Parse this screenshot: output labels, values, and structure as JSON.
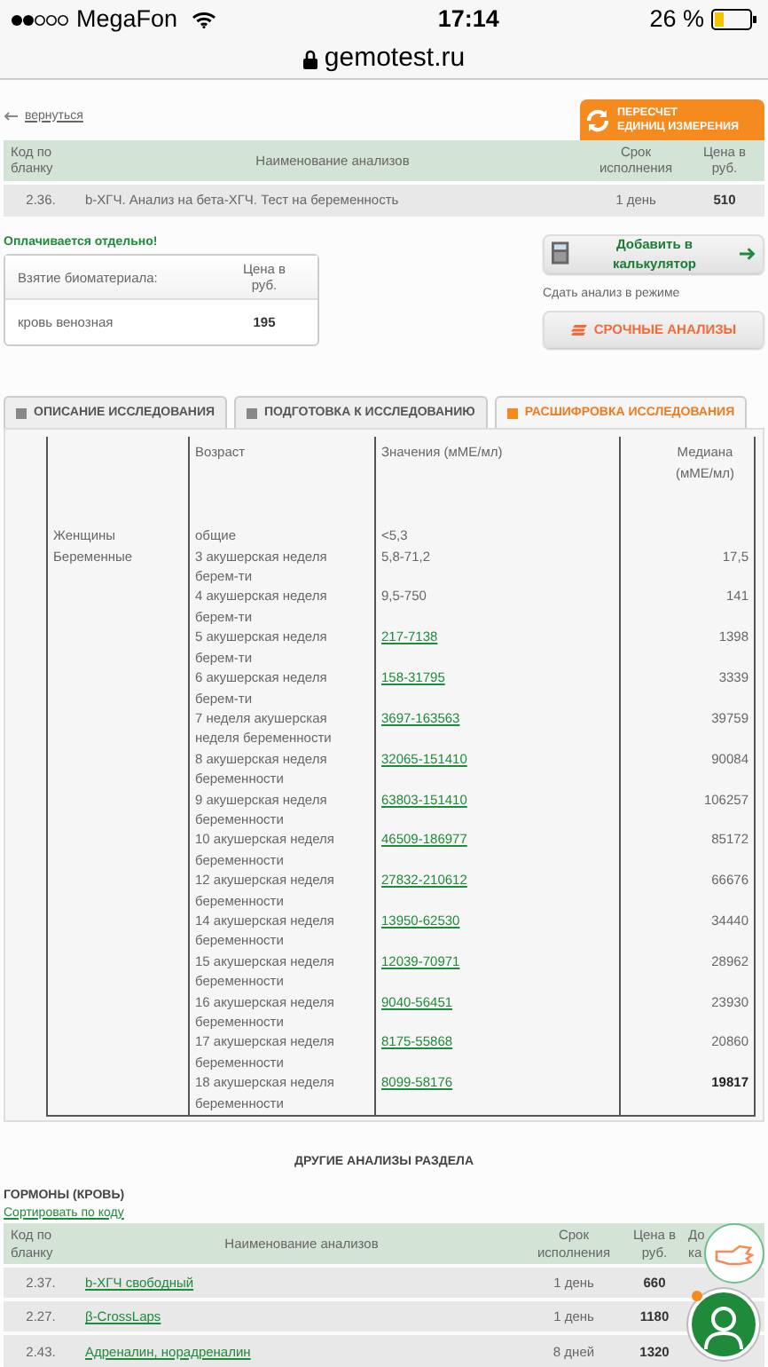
{
  "status_bar": {
    "carrier": "MegaFon",
    "time": "17:14",
    "battery": "26 %"
  },
  "address_bar": {
    "url": "gemotest.ru"
  },
  "back_link": "вернуться",
  "recalc_button": {
    "lines": [
      "ПЕРЕСЧЕТ",
      "ЕДИНИЦ ИЗМЕРЕНИЯ"
    ]
  },
  "test_table": {
    "columns": [
      "Код по бланку",
      "Наименование анализов",
      "Срок исполнения",
      "Цена в руб."
    ],
    "rows": [
      {
        "code": "2.36.",
        "name": "b-ХГЧ. Анализ на бета-ХГЧ. Тест на беременность",
        "term": "1 день",
        "price": "510"
      }
    ]
  },
  "paid_separately": {
    "title": "Оплачивается отдельно!",
    "columns": [
      "Взятие биоматериала:",
      "Цена в руб."
    ],
    "rows": [
      {
        "name": "кровь венозная",
        "price": "195"
      }
    ]
  },
  "add_to_calculator": "Добавить в калькулятор",
  "mode_label": "Сдать анализ в режиме",
  "urgent_button": "СРОЧНЫЕ АНАЛИЗЫ",
  "tabs": [
    {
      "label": "ОПИСАНИЕ ИССЛЕДОВАНИЯ",
      "selected": false
    },
    {
      "label": "ПОДГОТОВКА К ИССЛЕДОВАНИЮ",
      "selected": false
    },
    {
      "label": "РАСШИФРОВКА ИССЛЕДОВАНИЯ",
      "selected": true
    }
  ],
  "reference_table": {
    "columns": [
      "",
      "Возраст",
      "Значения (мМЕ/мл)",
      "Медиана (мМЕ/мл)"
    ],
    "rows": [
      {
        "group": "Женщины",
        "age": "общие",
        "value": "<5,3",
        "link": false
      },
      {
        "group": "Беременные",
        "age": "3 акушерская неделя берем-ти",
        "value": "5,8-71,2",
        "link": false,
        "median": "17,5"
      },
      {
        "age": "4 акушерская неделя берем-ти",
        "value": "9,5-750",
        "link": false,
        "median": "141"
      },
      {
        "age": "5 акушерская неделя берем-ти",
        "value": "217-7138",
        "link": true,
        "median": "1398"
      },
      {
        "age": "6 акушерская неделя берем-ти",
        "value": "158-31795",
        "link": true,
        "median": "3339"
      },
      {
        "age": "7 неделя акушерская неделя беременности",
        "value": "3697-163563",
        "link": true,
        "median": "39759"
      },
      {
        "age": "8 акушерская неделя беременности",
        "value": "32065-151410",
        "link": true,
        "median": "90084"
      },
      {
        "age": "9 акушерская неделя беременности",
        "value": "63803-151410",
        "link": true,
        "median": "106257"
      },
      {
        "age": "10 акушерская неделя беременности",
        "value": "46509-186977",
        "link": true,
        "median": "85172"
      },
      {
        "age": "12 акушерская неделя беременности",
        "value": "27832-210612",
        "link": true,
        "median": "66676"
      },
      {
        "age": "14 акушерская неделя беременности",
        "value": "13950-62530",
        "link": true,
        "median": "34440"
      },
      {
        "age": "15 акушерская неделя беременности",
        "value": "12039-70971",
        "link": true,
        "median": "28962"
      },
      {
        "age": "16 акушерская неделя беременности",
        "value": "9040-56451",
        "link": true,
        "median": "23930"
      },
      {
        "age": "17 акушерская неделя беременности",
        "value": "8175-55868",
        "link": true,
        "median": "20860"
      },
      {
        "age": "18 акушерская неделя беременности",
        "value": "8099-58176",
        "link": true,
        "median": "19817"
      }
    ]
  },
  "other_tests": {
    "title": "ДРУГИЕ АНАЛИЗЫ РАЗДЕЛА",
    "section": "ГОРМОНЫ (КРОВЬ)",
    "sort_link": "Сортировать по коду",
    "columns": [
      "Код по бланку",
      "Наименование анализов",
      "Срок исполнения",
      "Цена в руб.",
      "До ка"
    ],
    "rows": [
      {
        "code": "2.37.",
        "name": "b-ХГЧ свободный",
        "term": "1 день",
        "price": "660"
      },
      {
        "code": "2.27.",
        "name": "β-CrossLaps",
        "term": "1 день",
        "price": "1180"
      },
      {
        "code": "2.43.",
        "name": "Адреналин, норадреналин",
        "term": "8 дней",
        "price": "1320"
      }
    ]
  }
}
